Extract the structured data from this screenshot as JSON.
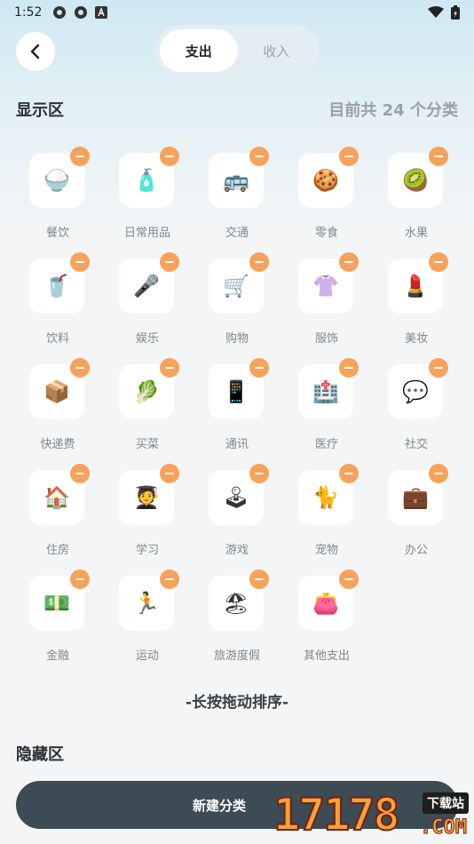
{
  "status_bar": {
    "time": "1:52",
    "left_icons": [
      "gear-icon",
      "gear-icon",
      "app-a-icon"
    ],
    "right_icons": [
      "wifi-icon",
      "battery-icon"
    ]
  },
  "header": {
    "tabs": [
      {
        "label": "支出",
        "active": true
      },
      {
        "label": "收入",
        "active": false
      }
    ]
  },
  "display_section": {
    "title": "显示区",
    "count_text": "目前共 24 个分类",
    "categories": [
      {
        "label": "餐饮",
        "icon": "🍚",
        "icon_name": "rice-bowl-icon"
      },
      {
        "label": "日常用品",
        "icon": "🧴",
        "icon_name": "lotion-bottle-icon"
      },
      {
        "label": "交通",
        "icon": "🚌",
        "icon_name": "bus-icon"
      },
      {
        "label": "零食",
        "icon": "🍪",
        "icon_name": "cookie-icon"
      },
      {
        "label": "水果",
        "icon": "🥝",
        "icon_name": "kiwi-icon"
      },
      {
        "label": "饮料",
        "icon": "🥤",
        "icon_name": "drink-cup-icon"
      },
      {
        "label": "娱乐",
        "icon": "🎤",
        "icon_name": "microphone-icon"
      },
      {
        "label": "购物",
        "icon": "🛒",
        "icon_name": "shopping-cart-icon"
      },
      {
        "label": "服饰",
        "icon": "👚",
        "icon_name": "blouse-icon"
      },
      {
        "label": "美妆",
        "icon": "💄",
        "icon_name": "lipstick-icon"
      },
      {
        "label": "快递费",
        "icon": "📦",
        "icon_name": "package-icon"
      },
      {
        "label": "买菜",
        "icon": "🥬",
        "icon_name": "leafy-greens-icon"
      },
      {
        "label": "通讯",
        "icon": "📱",
        "icon_name": "mobile-phone-icon"
      },
      {
        "label": "医疗",
        "icon": "🏥",
        "icon_name": "hospital-icon"
      },
      {
        "label": "社交",
        "icon": "💬",
        "icon_name": "speech-bubble-icon"
      },
      {
        "label": "住房",
        "icon": "🏠",
        "icon_name": "house-icon"
      },
      {
        "label": "学习",
        "icon": "🧑‍🎓",
        "icon_name": "student-icon"
      },
      {
        "label": "游戏",
        "icon": "🕹",
        "icon_name": "joystick-icon"
      },
      {
        "label": "宠物",
        "icon": "🐈",
        "icon_name": "cat-icon"
      },
      {
        "label": "办公",
        "icon": "💼",
        "icon_name": "briefcase-icon"
      },
      {
        "label": "金融",
        "icon": "💵",
        "icon_name": "banknote-icon"
      },
      {
        "label": "运动",
        "icon": "🏃",
        "icon_name": "runner-icon"
      },
      {
        "label": "旅游度假",
        "icon": "🏖",
        "icon_name": "beach-umbrella-icon"
      },
      {
        "label": "其他支出",
        "icon": "👛",
        "icon_name": "purse-icon"
      }
    ]
  },
  "sort_hint": "-长按拖动排序-",
  "hidden_section": {
    "title": "隐藏区"
  },
  "new_category_button": "新建分类",
  "watermark": {
    "digits": "17178",
    "tag": "下载站",
    "suffix": ".COM"
  }
}
